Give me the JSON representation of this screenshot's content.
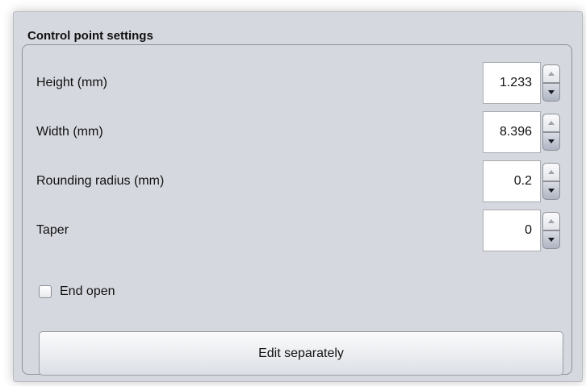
{
  "panel": {
    "title": "Control point settings"
  },
  "fields": [
    {
      "label": "Height (mm)",
      "value": "1.233"
    },
    {
      "label": "Width (mm)",
      "value": "8.396"
    },
    {
      "label": "Rounding radius (mm)",
      "value": "0.2"
    },
    {
      "label": "Taper",
      "value": "0"
    }
  ],
  "end_open": {
    "label": "End open",
    "checked": false
  },
  "edit_button": {
    "label": "Edit separately"
  },
  "icons": {
    "spinner_up": "triangle-up-icon",
    "spinner_down": "triangle-down-icon"
  }
}
